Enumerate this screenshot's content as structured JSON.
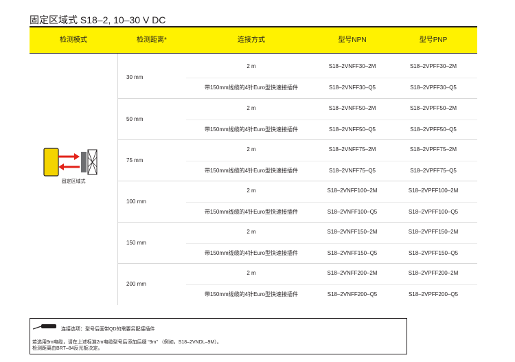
{
  "title": "固定区域式 S18–2, 10–30 V DC",
  "columns": [
    "检测模式",
    "检测距离*",
    "连接方式",
    "型号NPN",
    "型号PNP"
  ],
  "mode_label": "固定区域式",
  "colors": {
    "header": "#fff200",
    "sensor_body": "#f4d400",
    "arrows": "#e2231a",
    "target": "#6d6e71"
  },
  "groups": [
    {
      "range": "30 mm",
      "rows": [
        {
          "conn": "2 m",
          "npn": "S18–2VNFF30–2M",
          "pnp": "S18–2VPFF30–2M"
        },
        {
          "conn": "带150mm线缆的4针Euro型快速接插件",
          "npn": "S18–2VNFF30–Q5",
          "pnp": "S18–2VPFF30–Q5"
        }
      ]
    },
    {
      "range": "50 mm",
      "rows": [
        {
          "conn": "2 m",
          "npn": "S18–2VNFF50–2M",
          "pnp": "S18–2VPFF50–2M"
        },
        {
          "conn": "带150mm线缆的4针Euro型快速接插件",
          "npn": "S18–2VNFF50–Q5",
          "pnp": "S18–2VPFF50–Q5"
        }
      ]
    },
    {
      "range": "75 mm",
      "rows": [
        {
          "conn": "2 m",
          "npn": "S18–2VNFF75–2M",
          "pnp": "S18–2VPFF75–2M"
        },
        {
          "conn": "带150mm线缆的4针Euro型快速接插件",
          "npn": "S18–2VNFF75–Q5",
          "pnp": "S18–2VPFF75–Q5"
        }
      ]
    },
    {
      "range": "100 mm",
      "rows": [
        {
          "conn": "2 m",
          "npn": "S18–2VNFF100–2M",
          "pnp": "S18–2VPFF100–2M"
        },
        {
          "conn": "带150mm线缆的4针Euro型快速接插件",
          "npn": "S18–2VNFF100–Q5",
          "pnp": "S18–2VPFF100–Q5"
        }
      ]
    },
    {
      "range": "150 mm",
      "rows": [
        {
          "conn": "2 m",
          "npn": "S18–2VNFF150–2M",
          "pnp": "S18–2VPFF150–2M"
        },
        {
          "conn": "带150mm线缆的4针Euro型快速接插件",
          "npn": "S18–2VNFF150–Q5",
          "pnp": "S18–2VPFF150–Q5"
        }
      ]
    },
    {
      "range": "200 mm",
      "rows": [
        {
          "conn": "2 m",
          "npn": "S18–2VNFF200–2M",
          "pnp": "S18–2VPFF200–2M"
        },
        {
          "conn": "带150mm线缆的4针Euro型快速接插件",
          "npn": "S18–2VNFF200–Q5",
          "pnp": "S18–2VPFF200–Q5"
        }
      ]
    }
  ],
  "notes": {
    "connector_option": "连接选项：型号后面带QD的需要另配接插件",
    "cable_note": "若选用9m电缆，请在上述标准2m电缆型号后添加后缀 “9m” （例如，S18–2VNDL–9M）。",
    "range_note": "检测距离由BRT–84反光板决定。"
  }
}
